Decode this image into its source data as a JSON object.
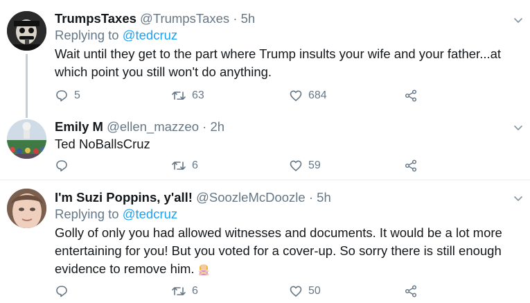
{
  "tweets": [
    {
      "name": "TrumpsTaxes",
      "handle": "@TrumpsTaxes",
      "separator": "·",
      "time": "5h",
      "replying_prefix": "Replying to",
      "replying_to": "@tedcruz",
      "text": "Wait until they get to the part where Trump insults your wife and your father...at which point you still won't do anything.",
      "replies": "5",
      "retweets": "63",
      "likes": "684"
    },
    {
      "name": "Emily M",
      "handle": "@ellen_mazzeo",
      "separator": "·",
      "time": "2h",
      "text": "Ted NoBallsCruz",
      "replies": "",
      "retweets": "6",
      "likes": "59"
    },
    {
      "name": "I'm Suzi Poppins, y'all!",
      "handle": "@SoozleMcDoozle",
      "separator": "·",
      "time": "5h",
      "replying_prefix": "Replying to",
      "replying_to": "@tedcruz",
      "text": "Golly of only you had allowed witnesses and documents. It would be a lot more entertaining for you! But you voted for a cover-up. So sorry there is still enough evidence to remove him.",
      "emoji": "person-gesturing-no-icon",
      "replies": "",
      "retweets": "6",
      "likes": "50"
    }
  ],
  "colors": {
    "accent": "#1da1f2",
    "secondary_text": "#657786",
    "primary_text": "#14171a",
    "thread_line": "#c4cfd6"
  }
}
